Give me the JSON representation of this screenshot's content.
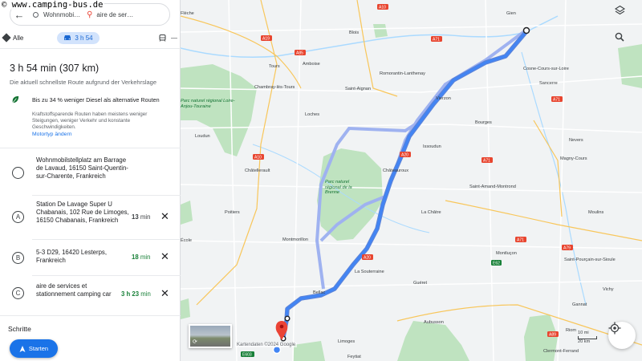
{
  "watermark": "© www.camping-bus.de",
  "search": {
    "origin": "Wohnmobi…",
    "destination": "aire de ser…"
  },
  "modes": {
    "all_label": "Alle",
    "car_time": "3 h 54"
  },
  "summary": {
    "title": "3 h 54 min (307 km)",
    "subtitle": "Die aktuell schnellste Route aufgrund der Verkehrslage"
  },
  "eco": {
    "headline": "Bis zu 34 % weniger Diesel als alternative Routen",
    "detail": "Kraftstoffsparende Routen haben meistens weniger Steigungen, weniger Verkehr und konstante Geschwindigkeiten.",
    "link": "Motortyp ändern"
  },
  "stops": [
    {
      "marker": "",
      "text": "Wohnmobilstellplatz am Barrage de Lavaud, 16150 Saint-Quentin-sur-Charente, Frankreich",
      "duration_num": "",
      "duration_unit": ""
    },
    {
      "marker": "A",
      "text": "Station De Lavage Super U Chabanais, 102 Rue de Limoges, 16150 Chabanais, Frankreich",
      "duration_num": "13",
      "duration_unit": " min"
    },
    {
      "marker": "B",
      "text": "5-3 D29, 16420 Lesterps, Frankreich",
      "duration_num": "18",
      "duration_unit": " min"
    },
    {
      "marker": "C",
      "text": "aire de services et stationnement camping car",
      "duration_num": "3 h 23",
      "duration_unit": " min"
    }
  ],
  "steps_label": "Schritte",
  "start_label": "Starten",
  "map": {
    "credits": "Kartendaten ©2024 Google",
    "scale_label": "10 mi",
    "scale_label2": "20 km",
    "cities": {
      "fleche": "Flèche",
      "blois": "Blois",
      "gien": "Gien",
      "amboise": "Amboise",
      "tours": "Tours",
      "chambray": "Chambray-lès-Tours",
      "romorantin": "Romorantin-Lanthenay",
      "saintaignan": "Saint-Aignan",
      "vierzon": "Vierzon",
      "cosne": "Cosne-Cours-sur-Loire",
      "sancerre": "Sancerre",
      "loches": "Loches",
      "bourges": "Bourges",
      "loudun": "Loudun",
      "issoudun": "Issoudun",
      "nevers": "Nevers",
      "magny": "Magny-Cours",
      "chatellerault": "Châtellerault",
      "chateauroux": "Châteauroux",
      "saintamand": "Saint-Amand-Montrond",
      "poitiers": "Poitiers",
      "lachatre": "La Châtre",
      "moulins": "Moulins",
      "montmorillon": "Montmorillon",
      "montlucon": "Montluçon",
      "saintpourcain": "Saint-Pourçain-sur-Sioule",
      "lasouterraine": "La Souterraine",
      "gueret": "Guéret",
      "bellac": "Bellac",
      "vichy": "Vichy",
      "gannat": "Gannat",
      "aubusson": "Aubusson",
      "riom": "Riom",
      "clermont": "Clermont-Ferrand",
      "limoges": "Limoges",
      "feytiat": "Feytiat",
      "ecole": "École"
    },
    "parks": {
      "touraine": "Parc naturel régional Loire-Anjou-Touraine",
      "brenne": "Parc naturel régional de la Brenne"
    },
    "roads": [
      "A10",
      "A19",
      "A71",
      "A85",
      "A20",
      "A20",
      "A71",
      "A71",
      "A79",
      "A89",
      "E62",
      "E603",
      "A10",
      "A71"
    ]
  }
}
